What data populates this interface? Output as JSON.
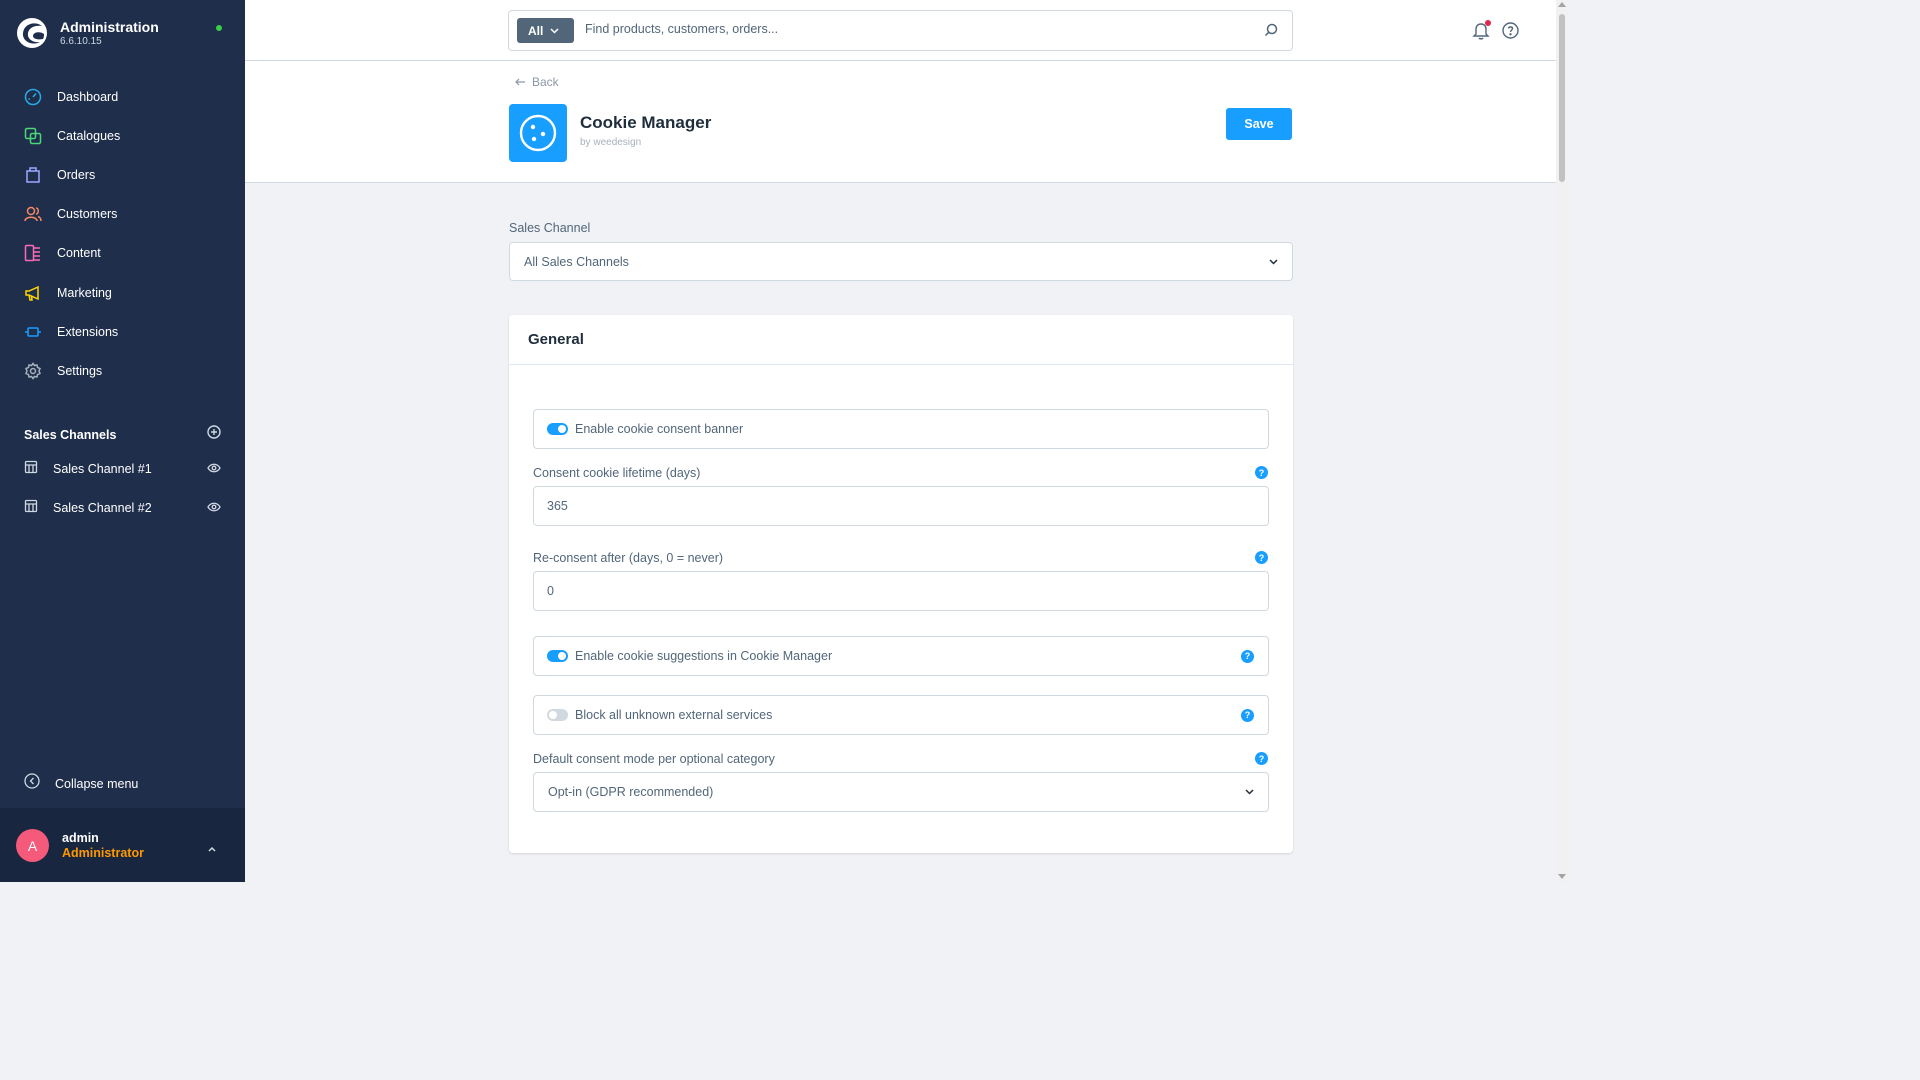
{
  "app": {
    "title": "Administration",
    "version": "6.6.10.15",
    "status_color": "#37d046",
    "accent": "#189eff"
  },
  "sidebar": {
    "items": [
      {
        "label": "Dashboard",
        "icon": "dashboard-icon",
        "color": "#29a9eb"
      },
      {
        "label": "Catalogues",
        "icon": "catalogues-icon",
        "color": "#4bd67a"
      },
      {
        "label": "Orders",
        "icon": "orders-icon",
        "color": "#9aa8ff"
      },
      {
        "label": "Customers",
        "icon": "customers-icon",
        "color": "#f88962"
      },
      {
        "label": "Content",
        "icon": "content-icon",
        "color": "#ff68b4"
      },
      {
        "label": "Marketing",
        "icon": "marketing-icon",
        "color": "#ffd700"
      },
      {
        "label": "Extensions",
        "icon": "extensions-icon",
        "color": "#189eff"
      },
      {
        "label": "Settings",
        "icon": "settings-icon",
        "color": "#a7b1bd"
      }
    ],
    "sales_channels_title": "Sales Channels",
    "sales_channels": [
      {
        "label": "Sales Channel #1"
      },
      {
        "label": "Sales Channel #2"
      }
    ],
    "collapse_label": "Collapse menu"
  },
  "user": {
    "initial": "A",
    "name": "admin",
    "role": "Administrator"
  },
  "search": {
    "type_label": "All",
    "placeholder": "Find products, customers, orders..."
  },
  "header": {
    "back_label": "Back",
    "app_title": "Cookie Manager",
    "by_prefix": "by",
    "author": "weedesign",
    "save_label": "Save"
  },
  "sales_channel_select": {
    "label": "Sales Channel",
    "value": "All Sales Channels"
  },
  "general": {
    "title": "General",
    "enable_banner": {
      "label": "Enable cookie consent banner",
      "checked": true
    },
    "lifetime": {
      "label": "Consent cookie lifetime (days)",
      "value": "365"
    },
    "reconsent": {
      "label": "Re-consent after (days, 0 = never)",
      "value": "0"
    },
    "suggestions": {
      "label": "Enable cookie suggestions in Cookie Manager",
      "checked": true
    },
    "block_unknown": {
      "label": "Block all unknown external services",
      "checked": false
    },
    "consent_mode": {
      "label": "Default consent mode per optional category",
      "value": "Opt-in (GDPR recommended)"
    }
  }
}
